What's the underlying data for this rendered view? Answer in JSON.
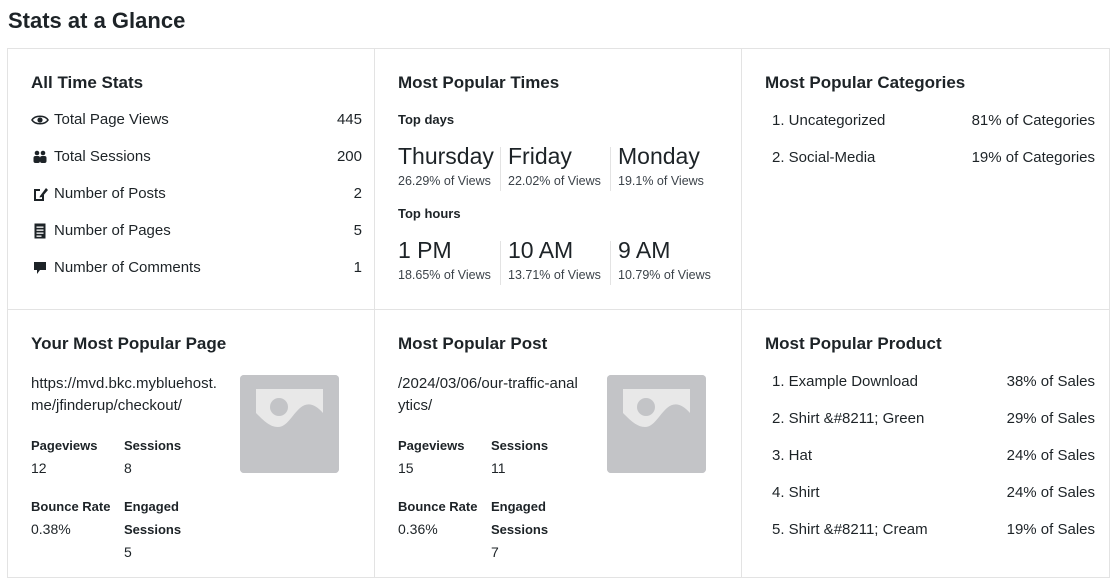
{
  "page": {
    "title": "Stats at a Glance"
  },
  "all_time": {
    "title": "All Time Stats",
    "rows": [
      {
        "label": "Total Page Views",
        "value": "445",
        "icon": "eye-icon"
      },
      {
        "label": "Total Sessions",
        "value": "200",
        "icon": "people-icon"
      },
      {
        "label": "Number of Posts",
        "value": "2",
        "icon": "post-edit-icon"
      },
      {
        "label": "Number of Pages",
        "value": "5",
        "icon": "page-icon"
      },
      {
        "label": "Number of Comments",
        "value": "1",
        "icon": "comment-icon"
      }
    ]
  },
  "popular_times": {
    "title": "Most Popular Times",
    "days_label": "Top days",
    "days": [
      {
        "name": "Thursday",
        "pct": "26.29% of Views"
      },
      {
        "name": "Friday",
        "pct": "22.02% of Views"
      },
      {
        "name": "Monday",
        "pct": "19.1% of Views"
      }
    ],
    "hours_label": "Top hours",
    "hours": [
      {
        "name": "1 PM",
        "pct": "18.65% of Views"
      },
      {
        "name": "10 AM",
        "pct": "13.71% of Views"
      },
      {
        "name": "9 AM",
        "pct": "10.79% of Views"
      }
    ]
  },
  "popular_categories": {
    "title": "Most Popular Categories",
    "items": [
      {
        "label": "1. Uncategorized",
        "value": "81% of Categories"
      },
      {
        "label": "2. Social-Media",
        "value": "19% of Categories"
      }
    ]
  },
  "popular_page": {
    "title": "Your Most Popular Page",
    "url": "https://mvd.bkc.mybluehost.me/jfinderup/checkout/",
    "pageviews_label": "Pageviews",
    "pageviews": "12",
    "sessions_label": "Sessions",
    "sessions": "8",
    "bounce_label": "Bounce Rate",
    "bounce": "0.38%",
    "engaged_label_1": "Engaged",
    "engaged_label_2": "Sessions",
    "engaged": "5"
  },
  "popular_post": {
    "title": "Most Popular Post",
    "url": "/2024/03/06/our-traffic-analytics/",
    "pageviews_label": "Pageviews",
    "pageviews": "15",
    "sessions_label": "Sessions",
    "sessions": "11",
    "bounce_label": "Bounce Rate",
    "bounce": "0.36%",
    "engaged_label_1": "Engaged",
    "engaged_label_2": "Sessions",
    "engaged": "7"
  },
  "popular_product": {
    "title": "Most Popular Product",
    "items": [
      {
        "label": "1. Example Download",
        "value": "38% of Sales"
      },
      {
        "label": "2. Shirt &#8211; Green",
        "value": "29% of Sales"
      },
      {
        "label": "3. Hat",
        "value": "24% of Sales"
      },
      {
        "label": "4. Shirt",
        "value": "24% of Sales"
      },
      {
        "label": "5. Shirt &#8211; Cream",
        "value": "19% of Sales"
      }
    ]
  },
  "colors": {
    "border": "#e3e3e3",
    "placeholder": "#c3c4c7",
    "text": "#1d2327"
  }
}
